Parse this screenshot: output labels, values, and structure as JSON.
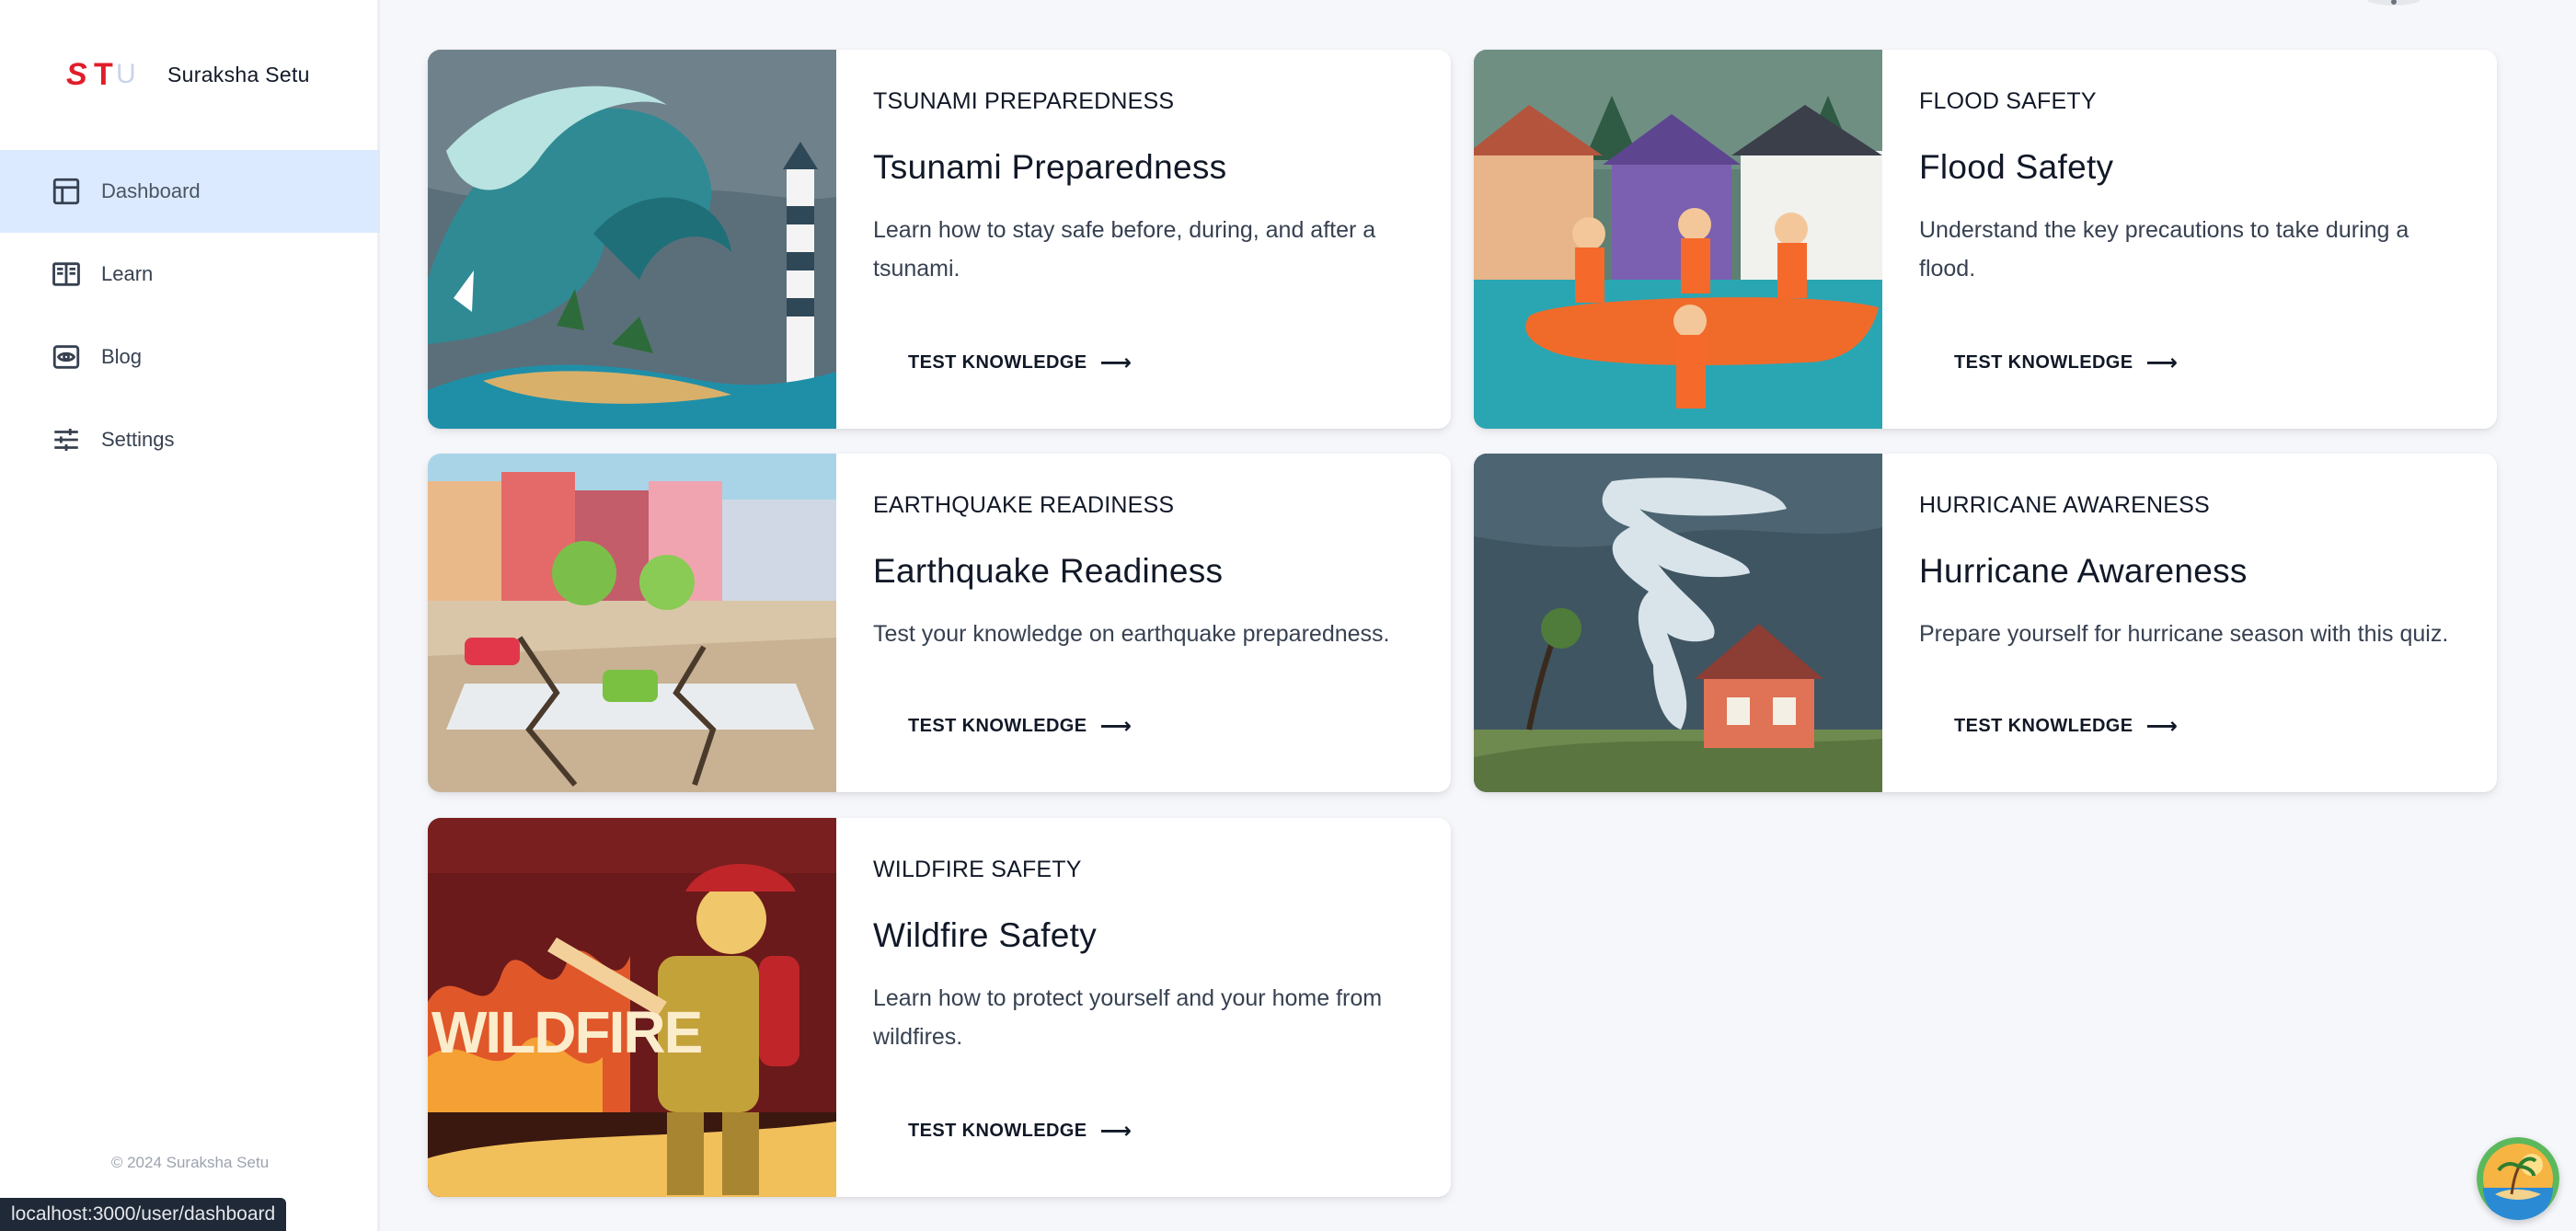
{
  "brand": {
    "logo_text": "STU",
    "name": "Suraksha Setu"
  },
  "sidebar": {
    "items": [
      {
        "label": "Dashboard",
        "icon": "dashboard-icon",
        "active": true
      },
      {
        "label": "Learn",
        "icon": "book-icon",
        "active": false
      },
      {
        "label": "Blog",
        "icon": "eye-icon",
        "active": false
      },
      {
        "label": "Settings",
        "icon": "sliders-icon",
        "active": false
      }
    ],
    "copyright": "© 2024 Suraksha Setu"
  },
  "status_url": "localhost:3000/user/dashboard",
  "cards": [
    {
      "category": "TSUNAMI PREPAREDNESS",
      "title": "Tsunami Preparedness",
      "description": "Learn how to stay safe before, during, and after a tsunami.",
      "button": "TEST KNOWLEDGE",
      "image": "tsunami-illustration"
    },
    {
      "category": "FLOOD SAFETY",
      "title": "Flood Safety",
      "description": "Understand the key precautions to take during a flood.",
      "button": "TEST KNOWLEDGE",
      "image": "flood-illustration"
    },
    {
      "category": "EARTHQUAKE READINESS",
      "title": "Earthquake Readiness",
      "description": "Test your knowledge on earthquake preparedness.",
      "button": "TEST KNOWLEDGE",
      "image": "earthquake-illustration"
    },
    {
      "category": "HURRICANE AWARENESS",
      "title": "Hurricane Awareness",
      "description": "Prepare yourself for hurricane season with this quiz.",
      "button": "TEST KNOWLEDGE",
      "image": "hurricane-illustration"
    },
    {
      "category": "WILDFIRE SAFETY",
      "title": "Wildfire Safety",
      "description": "Learn how to protect yourself and your home from wildfires.",
      "button": "TEST KNOWLEDGE",
      "image": "wildfire-illustration",
      "image_text": "WILDFIRE"
    }
  ],
  "colors": {
    "active_nav_bg": "#dbeafe",
    "logo_red": "#e11d2a",
    "page_bg": "#f6f7fb"
  }
}
